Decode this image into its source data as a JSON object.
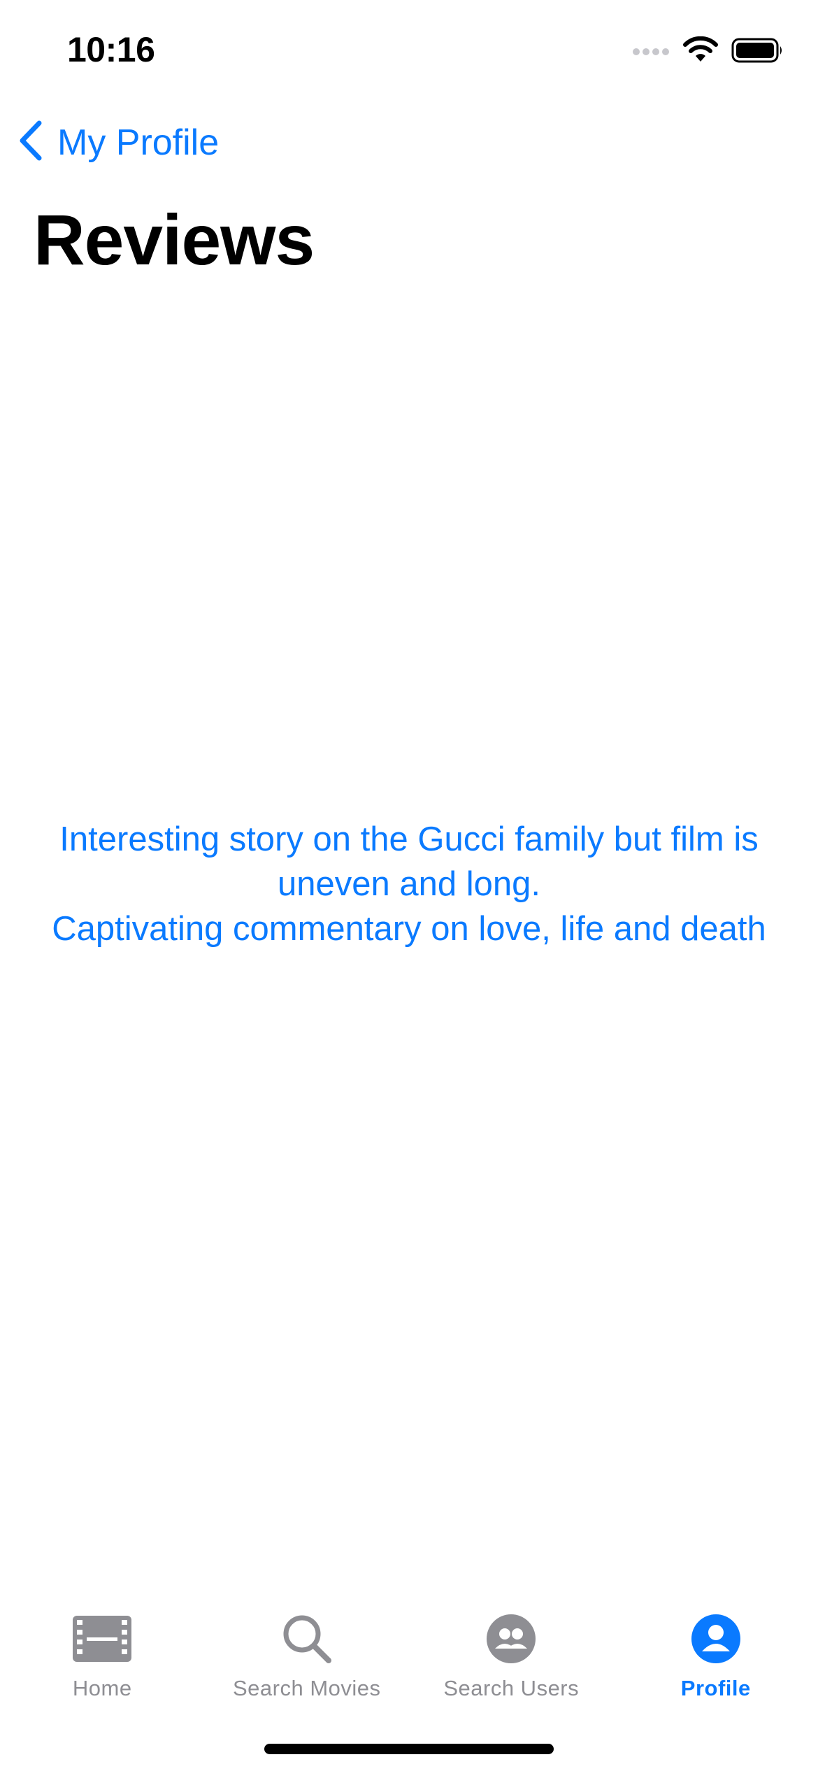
{
  "status_bar": {
    "time": "10:16",
    "icons": [
      "cellular-signal-icon",
      "wifi-icon",
      "battery-icon"
    ]
  },
  "nav": {
    "back_label": "My Profile",
    "back_icon": "chevron-left-icon"
  },
  "page": {
    "title": "Reviews"
  },
  "reviews": [
    "Interesting story on the Gucci family but film is uneven and long.",
    "Captivating commentary on love, life and death"
  ],
  "tab_bar": {
    "tabs": [
      {
        "label": "Home",
        "icon": "film-icon",
        "active": false
      },
      {
        "label": "Search Movies",
        "icon": "magnifying-glass-icon",
        "active": false
      },
      {
        "label": "Search Users",
        "icon": "people-icon",
        "active": false
      },
      {
        "label": "Profile",
        "icon": "person-icon",
        "active": true
      }
    ]
  },
  "colors": {
    "accent": "#0a7aff",
    "inactive": "#8e8e93",
    "background": "#ffffff",
    "text": "#000000"
  }
}
